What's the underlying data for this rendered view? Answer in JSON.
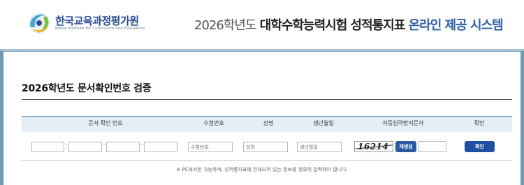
{
  "header": {
    "logo": {
      "name_kr": "한국교육과정평가원",
      "name_en": "Korea Institute for Curriculum and Evaluation"
    },
    "title_year": "2026학년도",
    "title_main": "대학수학능력시험 성적통지표",
    "title_sub": "온라인 제공 시스템",
    "colors": {
      "title_accent": "#2f5fa8",
      "band": "#6f9ab1"
    }
  },
  "main": {
    "page_title": "2026학년도 문서확인번호 검증",
    "table": {
      "headers": {
        "doc_number": "문서 확인 번호",
        "exam_number": "수험번호",
        "name": "성명",
        "birthdate": "생년월일",
        "captcha": "자동입력방지문자",
        "confirm": "확인"
      },
      "doc_number_values": [
        "",
        "",
        "",
        ""
      ],
      "exam_number_placeholder": "수험번호",
      "name_placeholder": "성명",
      "birthdate_placeholder": "생년월일",
      "captcha_text": "16214",
      "captcha_input_value": "",
      "regen_label": "재생성",
      "confirm_label": "확인"
    },
    "notice": "※ PC에서만 가능하며, 성적통지표에 인쇄되어 있는 정보를 정확히 입력해야 합니다."
  },
  "icons": {
    "logo": "kice-logo-icon"
  }
}
